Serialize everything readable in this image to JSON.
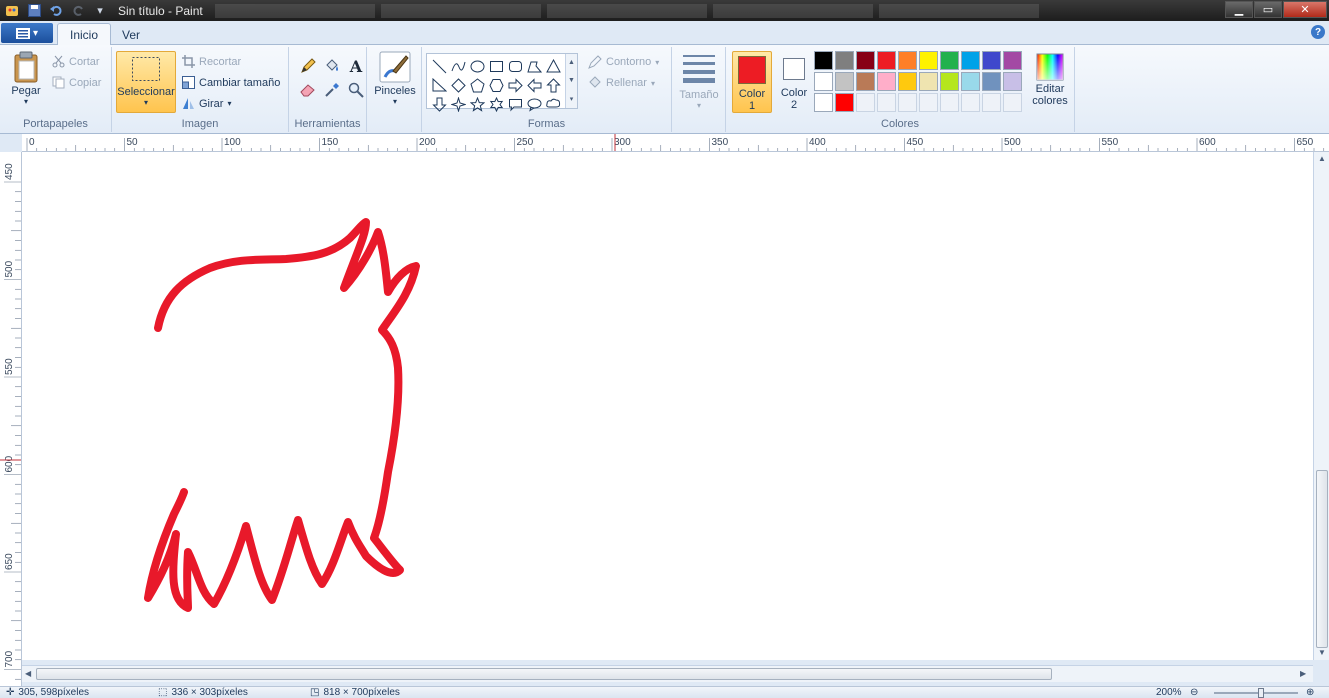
{
  "window": {
    "title": "Sin título - Paint",
    "controls": {
      "minimize": "▁",
      "maximize": "▭",
      "close": "✕"
    }
  },
  "tabs": [
    {
      "label": "Inicio",
      "active": true
    },
    {
      "label": "Ver",
      "active": false
    }
  ],
  "ribbon": {
    "clipboard": {
      "group_label": "Portapapeles",
      "paste": "Pegar",
      "cut": "Cortar",
      "copy": "Copiar"
    },
    "image": {
      "group_label": "Imagen",
      "select": "Seleccionar",
      "crop": "Recortar",
      "resize": "Cambiar tamaño",
      "rotate": "Girar"
    },
    "tools": {
      "group_label": "Herramientas"
    },
    "brushes": {
      "label": "Pinceles"
    },
    "shapes": {
      "group_label": "Formas",
      "outline": "Contorno",
      "fill": "Rellenar"
    },
    "size": {
      "label": "Tamaño"
    },
    "colors": {
      "group_label": "Colores",
      "color1_line1": "Color",
      "color1_line2": "1",
      "color2_line1": "Color",
      "color2_line2": "2",
      "edit_line1": "Editar",
      "edit_line2": "colores",
      "color1_value": "#ed1c24",
      "color2_value": "#ffffff",
      "palette": [
        "#000000",
        "#7f7f7f",
        "#880015",
        "#ed1c24",
        "#ff7f27",
        "#fff200",
        "#22b14c",
        "#00a2e8",
        "#3f48cc",
        "#a349a4",
        "#ffffff",
        "#c3c3c3",
        "#b97a57",
        "#ffaec9",
        "#ffc90e",
        "#efe4b0",
        "#b5e61d",
        "#99d9ea",
        "#7092be",
        "#c8bfe7",
        "#ffffff",
        "#ff0000",
        "",
        "",
        "",
        "",
        "",
        "",
        "",
        ""
      ]
    }
  },
  "rulers": {
    "horizontal_labels": [
      "0",
      "50",
      "100",
      "150",
      "200",
      "250",
      "300",
      "350",
      "400",
      "450",
      "500",
      "550",
      "600",
      "650"
    ],
    "vertical_labels": [
      "450",
      "500",
      "550",
      "600",
      "650",
      "700"
    ]
  },
  "status": {
    "cursor": "305, 598píxeles",
    "selection": "336 × 303píxeles",
    "canvas_size": "818 × 700píxeles",
    "zoom": "200%"
  }
}
